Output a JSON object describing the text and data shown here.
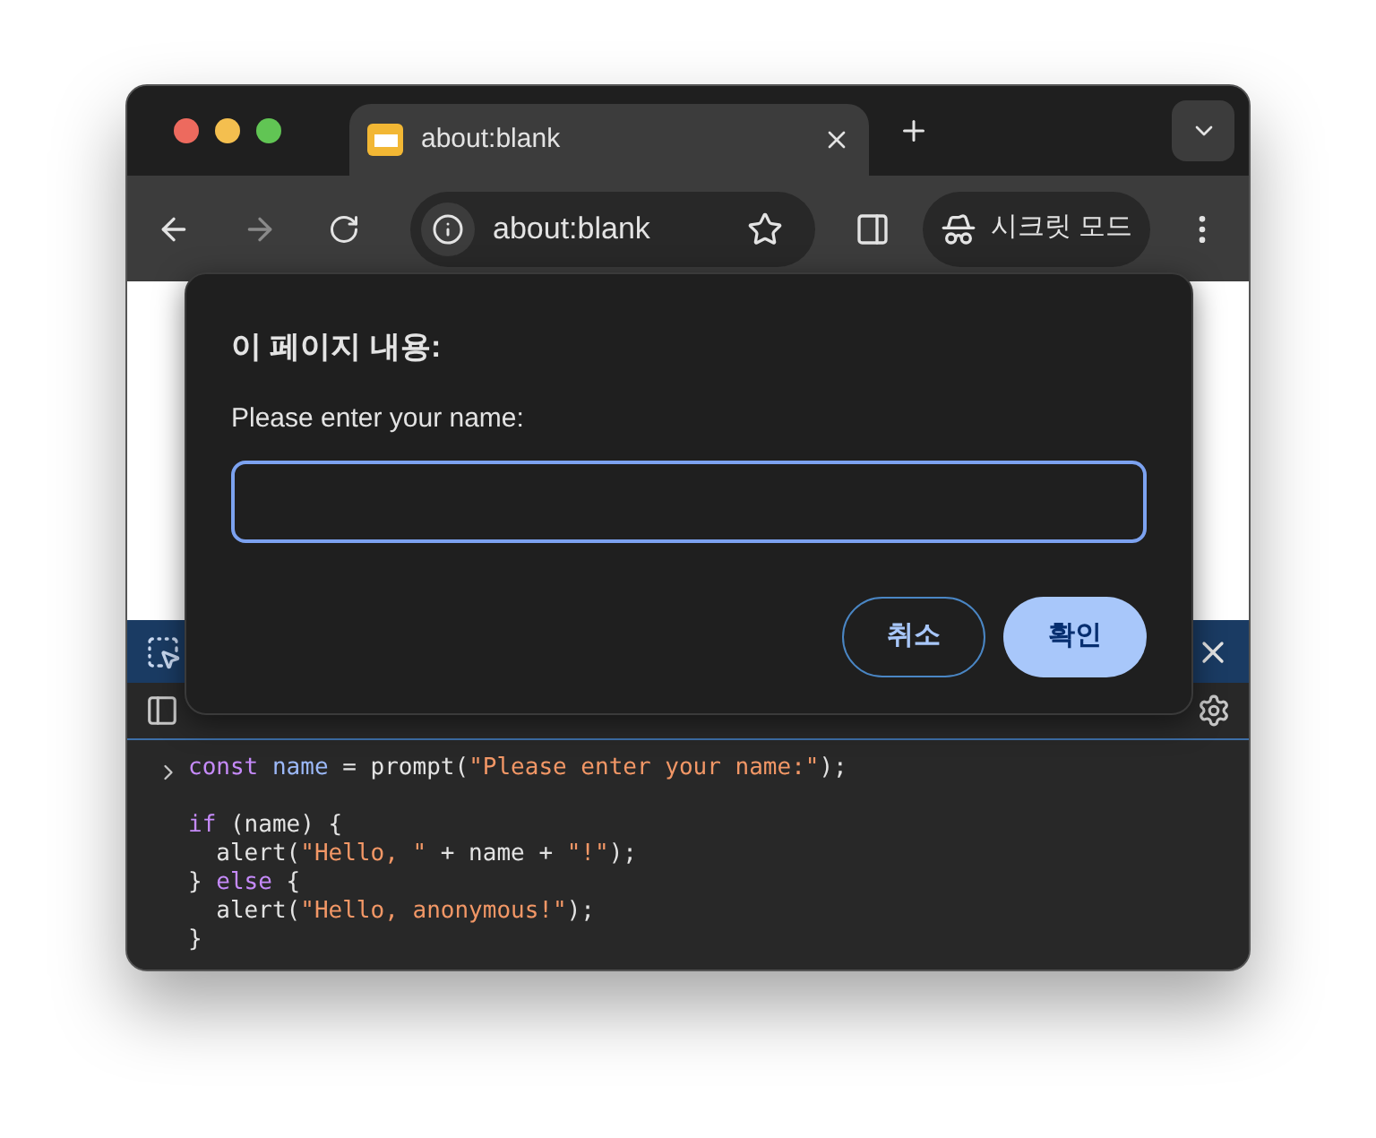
{
  "tab": {
    "title": "about:blank"
  },
  "navigation": {
    "forward_disabled": true
  },
  "address_bar": {
    "url": "about:blank"
  },
  "incognito": {
    "label": "시크릿 모드"
  },
  "dialog": {
    "title": "이 페이지 내용:",
    "message": "Please enter your name:",
    "input": {
      "focused": true
    },
    "buttons": [
      {
        "label": "취소",
        "kind": "secondary"
      },
      {
        "label": "확인",
        "kind": "primary"
      }
    ]
  },
  "console": {
    "lines": [
      {
        "tokens": [
          {
            "text": "const ",
            "kind": "keyword"
          },
          {
            "text": "name",
            "kind": "variable"
          },
          {
            "text": " = prompt("
          },
          {
            "text": "\"Please enter your name:\"",
            "kind": "string"
          },
          {
            "text": ");"
          }
        ]
      },
      {
        "blank": true
      },
      {
        "tokens": [
          {
            "text": "if",
            "kind": "keyword"
          },
          {
            "text": " (name) {"
          }
        ]
      },
      {
        "tokens": [
          {
            "text": "  alert("
          },
          {
            "text": "\"Hello, \"",
            "kind": "string"
          },
          {
            "text": " + name + "
          },
          {
            "text": "\"!\"",
            "kind": "string"
          },
          {
            "text": ");"
          }
        ]
      },
      {
        "tokens": [
          {
            "text": "} "
          },
          {
            "text": "else",
            "kind": "keyword"
          },
          {
            "text": " {"
          }
        ]
      },
      {
        "tokens": [
          {
            "text": "  alert("
          },
          {
            "text": "\"Hello, anonymous!\"",
            "kind": "string"
          },
          {
            "text": ");"
          }
        ]
      },
      {
        "tokens": [
          {
            "text": "}"
          }
        ]
      }
    ]
  }
}
